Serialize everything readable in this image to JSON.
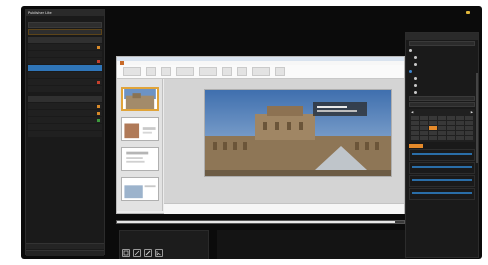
{
  "left_panel": {
    "title": "Publisher Lite",
    "subtitle": "",
    "fields": [
      "",
      ""
    ],
    "section_label": "",
    "rows": [
      {
        "label": "",
        "value": "",
        "marker": "orange",
        "label_style": "orange"
      },
      {
        "label": "",
        "value": "",
        "marker": "none"
      },
      {
        "label": "",
        "value": "",
        "marker": "red"
      },
      {
        "label": "",
        "value": "",
        "marker": "blue",
        "active": true
      },
      {
        "label": "",
        "value": "",
        "marker": "none"
      },
      {
        "label": "",
        "value": "",
        "marker": "red"
      },
      {
        "label": "",
        "value": "",
        "marker": "none"
      }
    ],
    "section2_label": "",
    "rows2": [
      {
        "label": "",
        "value": "",
        "marker": "orange"
      },
      {
        "label": "",
        "value": "",
        "marker": "orange"
      },
      {
        "label": "",
        "value": "",
        "marker": "green"
      },
      {
        "label": "",
        "value": "",
        "marker": "none"
      },
      {
        "label": "",
        "value": "",
        "marker": "none"
      }
    ],
    "bottom_items": [
      "",
      ""
    ]
  },
  "presentation_app": {
    "title": "",
    "tabs": [
      "",
      "",
      "",
      "",
      "",
      "",
      "",
      ""
    ],
    "active_tab_index": 0,
    "slide_count_visible": 4,
    "active_slide_index": 0,
    "notes_placeholder": ""
  },
  "timeline": {
    "progress": 0.97,
    "duration": ""
  },
  "media_panel": {
    "caption": ""
  },
  "info_panel": {
    "title": "",
    "lines": [
      "",
      "",
      ""
    ]
  },
  "topbar": {
    "items": [
      "",
      "",
      ""
    ]
  },
  "right_panel": {
    "title": "",
    "rows": [
      {
        "label": "",
        "indicator": "bullet"
      },
      {
        "label": "",
        "indicator": "bullet",
        "sub": true
      },
      {
        "label": "",
        "indicator": "bullet",
        "sub": true
      },
      {
        "label": "",
        "indicator": "blue"
      },
      {
        "label": "",
        "indicator": "bullet",
        "sub": true
      },
      {
        "label": "",
        "indicator": "bullet",
        "sub": true
      },
      {
        "label": "",
        "indicator": "bullet",
        "sub": true
      }
    ],
    "calendar_month": "",
    "calendar_selected_day": 17,
    "items": [
      "",
      "",
      "",
      ""
    ]
  },
  "colors": {
    "accent_blue": "#2f75b8",
    "accent_orange": "#e58a2a",
    "panel_bg": "#1a1a1a",
    "frame_bg": "#0b0b0b"
  }
}
